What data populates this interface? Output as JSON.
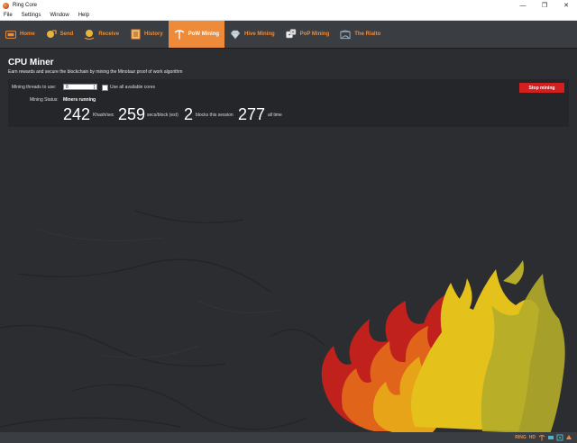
{
  "window": {
    "title": "Ring Core"
  },
  "menu": [
    "File",
    "Settings",
    "Window",
    "Help"
  ],
  "toolbar": {
    "items": [
      {
        "label": "Home"
      },
      {
        "label": "Send"
      },
      {
        "label": "Receive"
      },
      {
        "label": "History"
      },
      {
        "label": "PoW Mining"
      },
      {
        "label": "Hive Mining"
      },
      {
        "label": "PoP Mining"
      },
      {
        "label": "The Rialto"
      }
    ],
    "active": "PoW Mining",
    "accent_color": "#ee8b3a"
  },
  "page": {
    "title": "CPU Miner",
    "subtitle": "Earn rewards and secure the blockchain by mining the Minotaur proof of work algorithm"
  },
  "miner": {
    "threads_label": "Mining threads to use:",
    "threads_value": "8",
    "use_all_label": "Use all available cores",
    "status_label": "Mining Status:",
    "status_value": "Miners running",
    "stop_button": "Stop mining",
    "stop_color": "#d41f1f",
    "hashrate": "242",
    "hashrate_unit": "Khash/sec",
    "block_time": "259",
    "block_time_unit": "secs/block (est)",
    "blocks_session": "2",
    "blocks_session_label": "blocks this session",
    "blocks_all": "277",
    "blocks_all_label": "all time"
  },
  "statusbar": {
    "unit": "RING",
    "mode": "HD"
  }
}
